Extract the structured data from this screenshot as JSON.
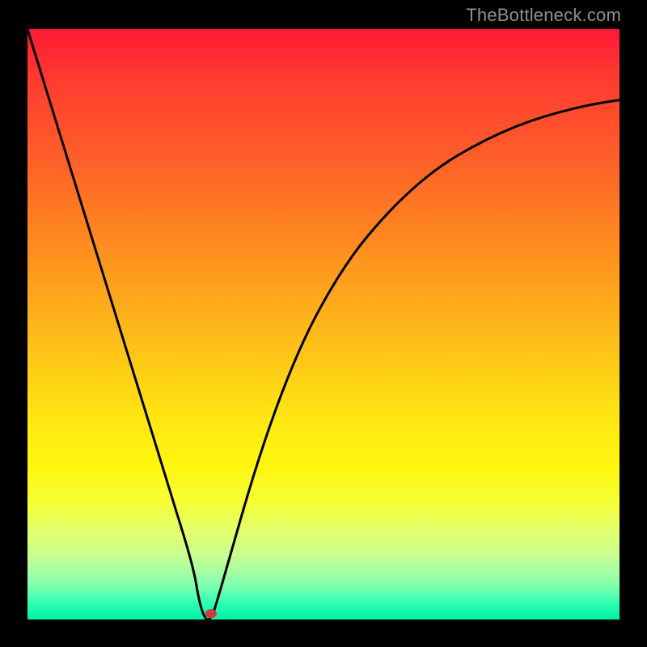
{
  "watermark": "TheBottleneck.com",
  "colors": {
    "frame": "#000000",
    "curve": "#000000",
    "marker": "#cf3a3a",
    "gradient_stops": [
      "#ff1836",
      "#ff5a2a",
      "#ffa31c",
      "#ffe712",
      "#fff60e",
      "#c8ff8e",
      "#00f1a7"
    ]
  },
  "chart_data": {
    "type": "line",
    "title": "",
    "xlabel": "",
    "ylabel": "",
    "xlim": [
      0,
      100
    ],
    "ylim": [
      0,
      100
    ],
    "x": [
      0,
      4,
      8,
      12,
      16,
      20,
      24,
      28,
      29,
      30,
      31,
      32,
      34,
      38,
      42,
      46,
      50,
      55,
      60,
      65,
      70,
      75,
      80,
      85,
      90,
      95,
      100
    ],
    "values": [
      100,
      87,
      74,
      61,
      48,
      35,
      22,
      9,
      3,
      0,
      0,
      3,
      10,
      24,
      36,
      46,
      54,
      62,
      68,
      73,
      77,
      80,
      82.5,
      84.5,
      86,
      87.2,
      88
    ],
    "marker": {
      "x": 31,
      "y": 1
    },
    "notes": "V-shaped bottleneck curve. Minimum near x≈30. Background gradient encodes severity: red=high, green=low."
  }
}
